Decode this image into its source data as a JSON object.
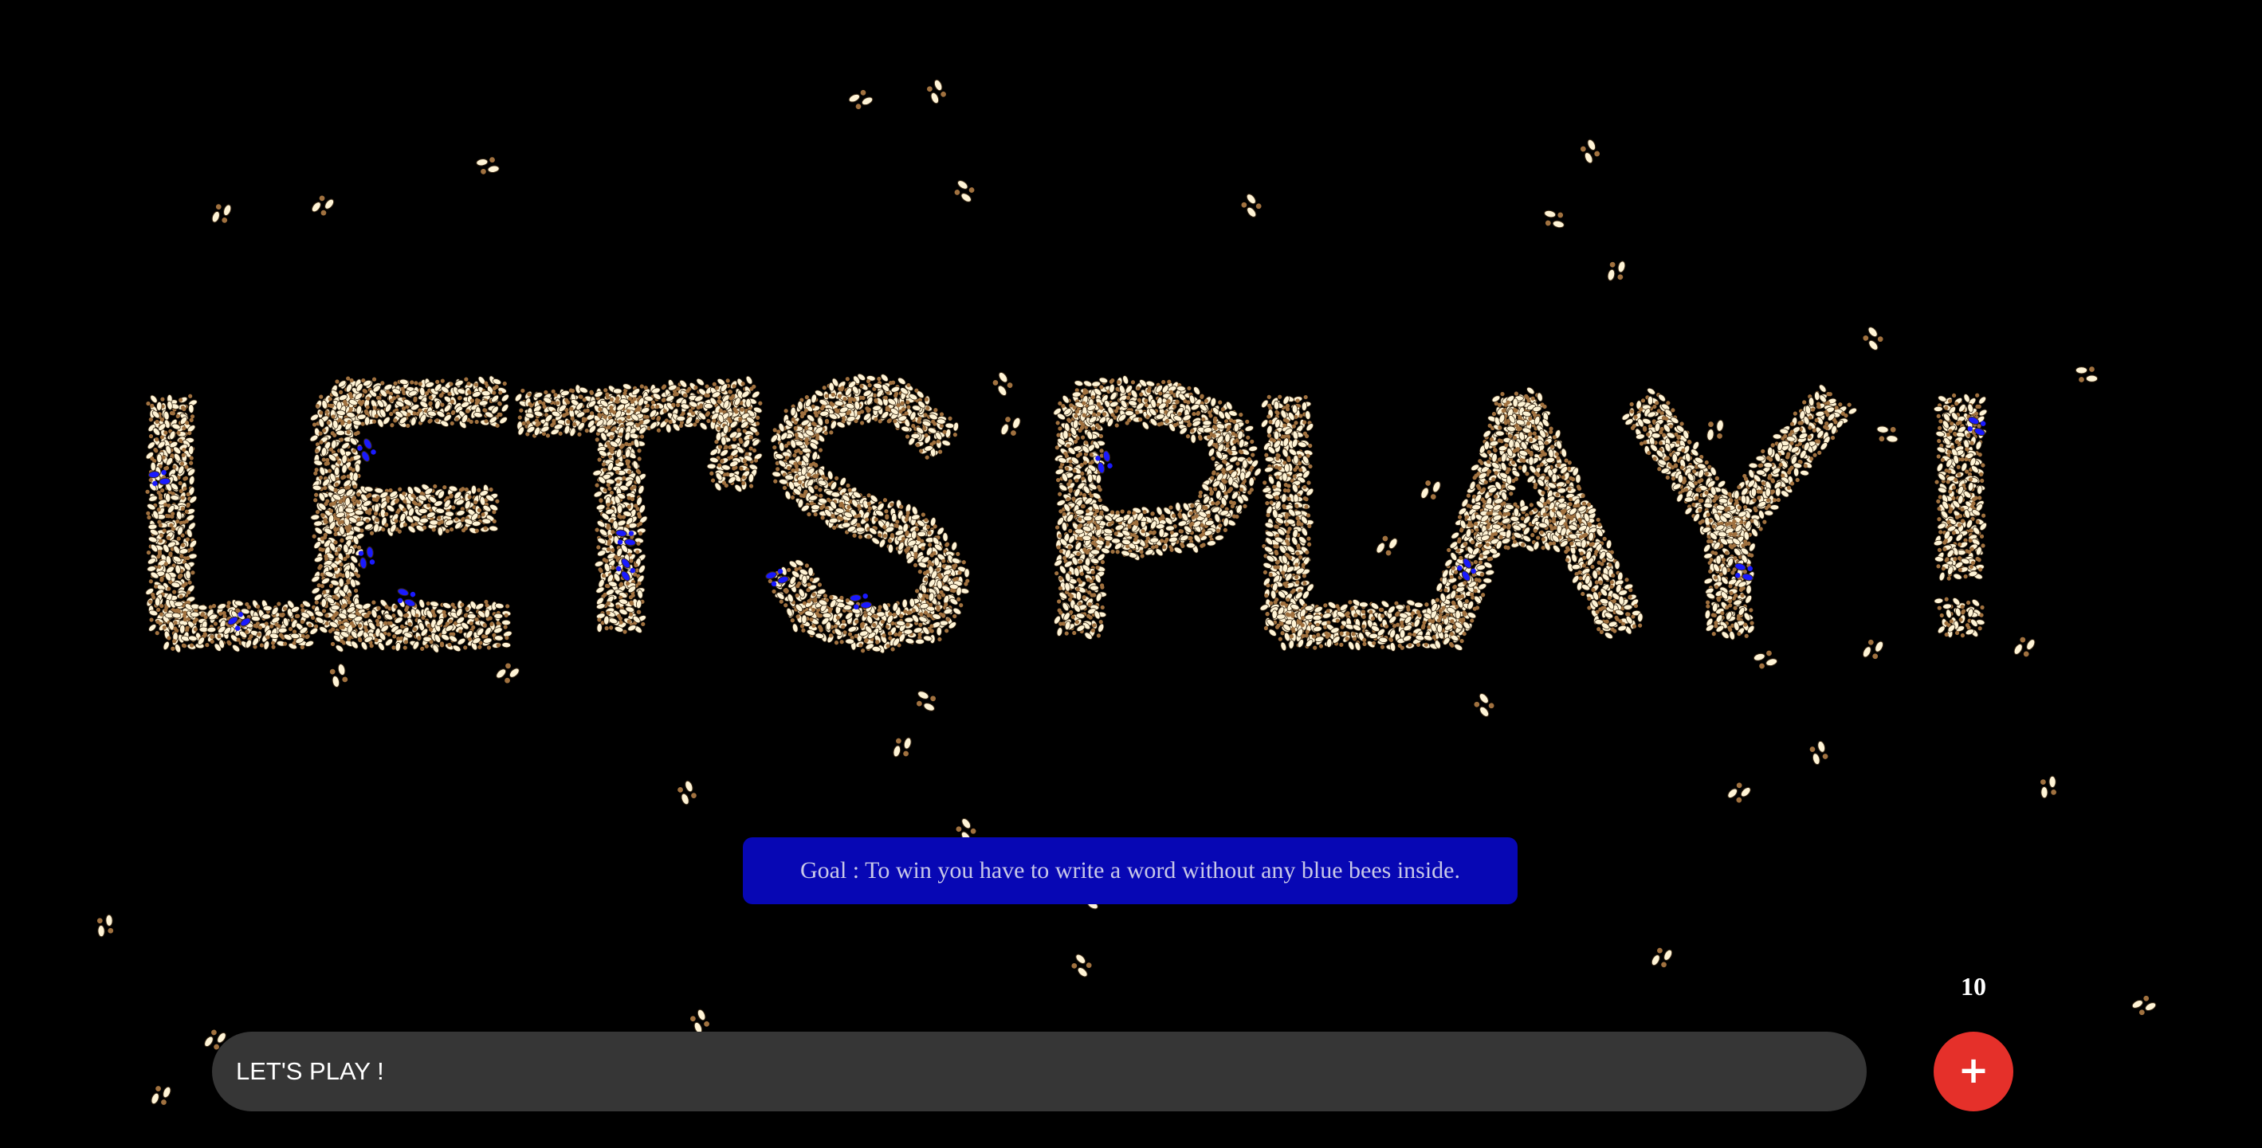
{
  "game": {
    "goal_text": "Goal : To win you have to write a word without any blue bees inside.",
    "input_value": "LET'S PLAY !",
    "counter": "10",
    "add_icon": "plus-icon"
  },
  "colors": {
    "background": "#000000",
    "bee_cream": "#fff4d6",
    "bee_brown": "#a0713f",
    "bee_blue": "#1a1aff",
    "goal_banner": "#0707b4",
    "input_background": "#363636",
    "add_button": "#e5302a"
  }
}
